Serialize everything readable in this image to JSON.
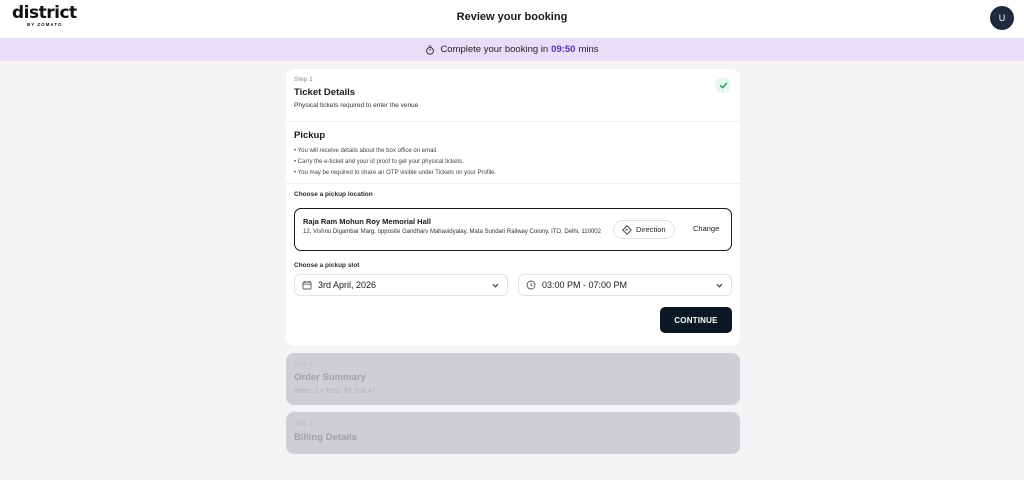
{
  "header": {
    "logo_text": "district",
    "logo_sub": "BY ZOMATO",
    "title": "Review your booking",
    "avatar_initial": "U"
  },
  "timer": {
    "prefix": "Complete your booking in",
    "time": "09:50",
    "suffix": "mins",
    "icon": "stopwatch-icon",
    "accent_color": "#5a2dbf"
  },
  "ticket_details": {
    "step": "Step 1",
    "title": "Ticket Details",
    "subtitle": "Physical tickets required to enter the venue",
    "status_icon": "check-icon"
  },
  "pickup": {
    "title": "Pickup",
    "bullets": [
      "You will receive details about the box office on email.",
      "Carry the e-ticket and your id proof to get your physical tickets.",
      "You may be required to share an OTP visible under Tickets on your Profile."
    ],
    "location_label": "Choose a pickup location",
    "location": {
      "name": "Raja Ram Mohun Roy Memorial Hall",
      "address": "12, Vishnu Digambar Marg, opposite Gandharv Mahavidyalay, Mata Sundari Railway Colony, ITO, Delhi, 110002",
      "direction_label": "Direction",
      "change_label": "Change"
    },
    "slot_label": "Choose a pickup slot",
    "date_value": "3rd April, 2026",
    "time_value": "03:00 PM - 07:00 PM",
    "continue_label": "CONTINUE"
  },
  "order_summary": {
    "step": "Step 2",
    "title": "Order Summary",
    "subtitle": "Items: 1 • Total: ₹2,516.47"
  },
  "billing_details": {
    "step": "Step 3",
    "title": "Billing Details"
  }
}
